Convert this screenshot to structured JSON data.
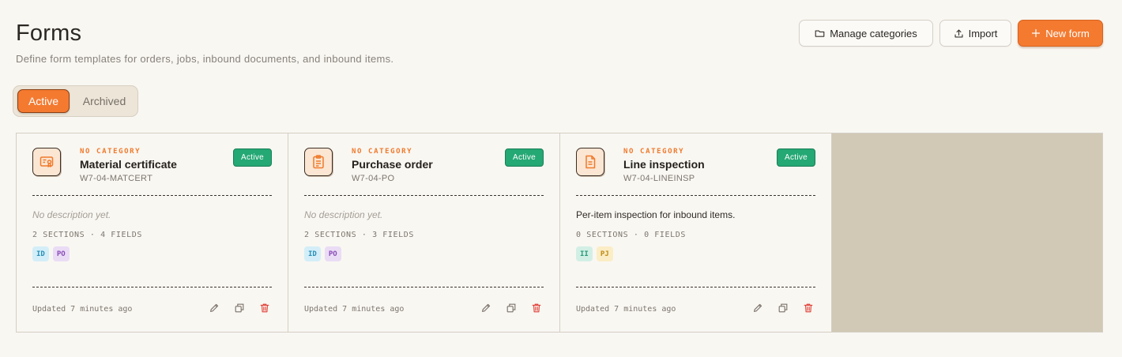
{
  "header": {
    "title": "Forms",
    "subtitle": "Define form templates for orders, jobs, inbound documents, and inbound items."
  },
  "toolbar": {
    "manage_label": "Manage categories",
    "import_label": "Import",
    "new_label": "New form"
  },
  "filter": {
    "active_label": "Active",
    "archived_label": "Archived"
  },
  "cards": [
    {
      "category": "NO CATEGORY",
      "title": "Material certificate",
      "code": "W7-04-MATCERT",
      "status": "Active",
      "description": "No description yet.",
      "description_empty": true,
      "meta": "2 SECTIONS · 4 FIELDS",
      "tags": [
        {
          "label": "ID",
          "bg": "#d3eef8",
          "fg": "#2a8fb8"
        },
        {
          "label": "PO",
          "bg": "#eadcf5",
          "fg": "#8a4bb8"
        }
      ],
      "updated": "Updated 7 minutes ago",
      "icon": "certificate-icon"
    },
    {
      "category": "NO CATEGORY",
      "title": "Purchase order",
      "code": "W7-04-PO",
      "status": "Active",
      "description": "No description yet.",
      "description_empty": true,
      "meta": "2 SECTIONS · 3 FIELDS",
      "tags": [
        {
          "label": "ID",
          "bg": "#d3eef8",
          "fg": "#2a8fb8"
        },
        {
          "label": "PO",
          "bg": "#eadcf5",
          "fg": "#8a4bb8"
        }
      ],
      "updated": "Updated 7 minutes ago",
      "icon": "clipboard-icon"
    },
    {
      "category": "NO CATEGORY",
      "title": "Line inspection",
      "code": "W7-04-LINEINSP",
      "status": "Active",
      "description": "Per-item inspection for inbound items.",
      "description_empty": false,
      "meta": "0 SECTIONS · 0 FIELDS",
      "tags": [
        {
          "label": "II",
          "bg": "#d2efe6",
          "fg": "#2a9a78"
        },
        {
          "label": "PJ",
          "bg": "#fbedc5",
          "fg": "#c08a14"
        }
      ],
      "updated": "Updated 7 minutes ago",
      "icon": "document-icon"
    }
  ],
  "colors": {
    "accent": "#f47a30",
    "status_active": "#24a874",
    "delete": "#e0443a"
  }
}
